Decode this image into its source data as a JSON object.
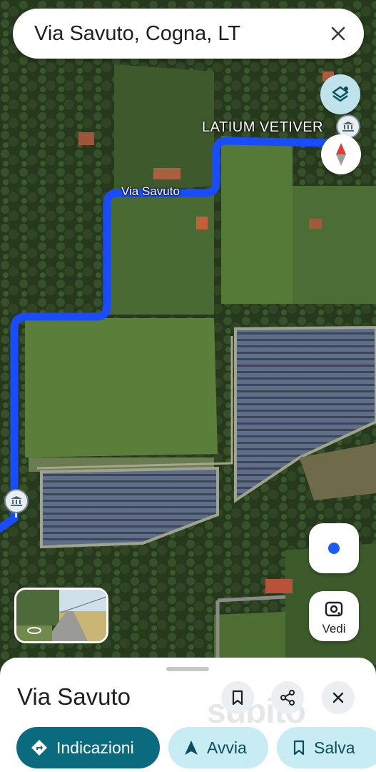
{
  "search": {
    "query": "Via Savuto, Cogna, LT"
  },
  "map": {
    "poi_label": "LATIUM VETIVER",
    "road_label": "Via Savuto",
    "route_color": "#1a4cff"
  },
  "lens": {
    "label": "Vedi"
  },
  "sheet": {
    "title": "Via Savuto",
    "watermark": "subito",
    "actions": {
      "directions": "Indicazioni",
      "start": "Avvia",
      "save": "Salva"
    }
  },
  "icons": [
    "close-icon",
    "layers-icon",
    "compass-icon",
    "museum-icon",
    "my-location-icon",
    "lens-icon",
    "bookmark-icon",
    "share-icon",
    "directions-icon",
    "navigation-icon"
  ]
}
